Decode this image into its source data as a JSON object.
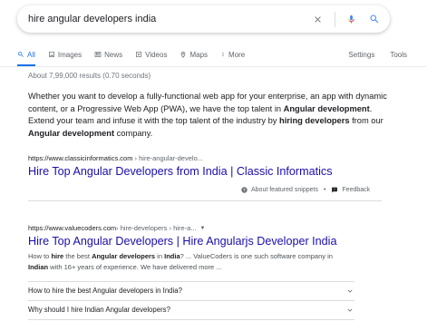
{
  "search": {
    "query": "hire angular developers india",
    "clear_icon": "close-icon",
    "mic_icon": "microphone-icon",
    "search_icon": "search-icon"
  },
  "tabs": {
    "all": "All",
    "images": "Images",
    "news": "News",
    "videos": "Videos",
    "maps": "Maps",
    "more": "More",
    "settings": "Settings",
    "tools": "Tools"
  },
  "result_stats": "About 7,99,000 results (0.70 seconds)",
  "featured": {
    "t1": "Whether you want to develop a fully-functional web app for your enterprise, an app with dynamic content, or a Progressive Web App (PWA), we have the top talent in ",
    "b1": "Angular development",
    "t2": ". Extend your team and infuse it with the top talent of the industry by ",
    "b2": "hiring developers",
    "t3": " from our ",
    "b3": "Angular development",
    "t4": " company.",
    "cite_domain": "https://www.classicinformatics.com",
    "cite_path": " › hire-angular-develo...",
    "title": "Hire Top Angular Developers from India | Classic Informatics",
    "about_label": "About featured snippets",
    "separator": "•",
    "feedback_label": "Feedback"
  },
  "result2": {
    "cite_domain": "https://www.valuecoders.com",
    "cite_path": " › hire-developers › hire-a...",
    "caret": "▼",
    "title": "Hire Top Angular Developers | Hire Angularjs Developer India",
    "d1": "How to ",
    "db1": "hire",
    "d2": " the best ",
    "db2": "Angular developers",
    "d3": " in ",
    "db3": "India",
    "d4": "? ... ValueCoders is one such software company in ",
    "db4": "Indian",
    "d5": " with 16+ years of experience. We have delivered more ..."
  },
  "faq": [
    {
      "question": "How to hire the best Angular developers in India?"
    },
    {
      "question": "Why should I hire Indian Angular developers?"
    }
  ],
  "colors": {
    "link": "#1a0dab",
    "accent": "#1a73e8",
    "muted": "#5f6368"
  }
}
